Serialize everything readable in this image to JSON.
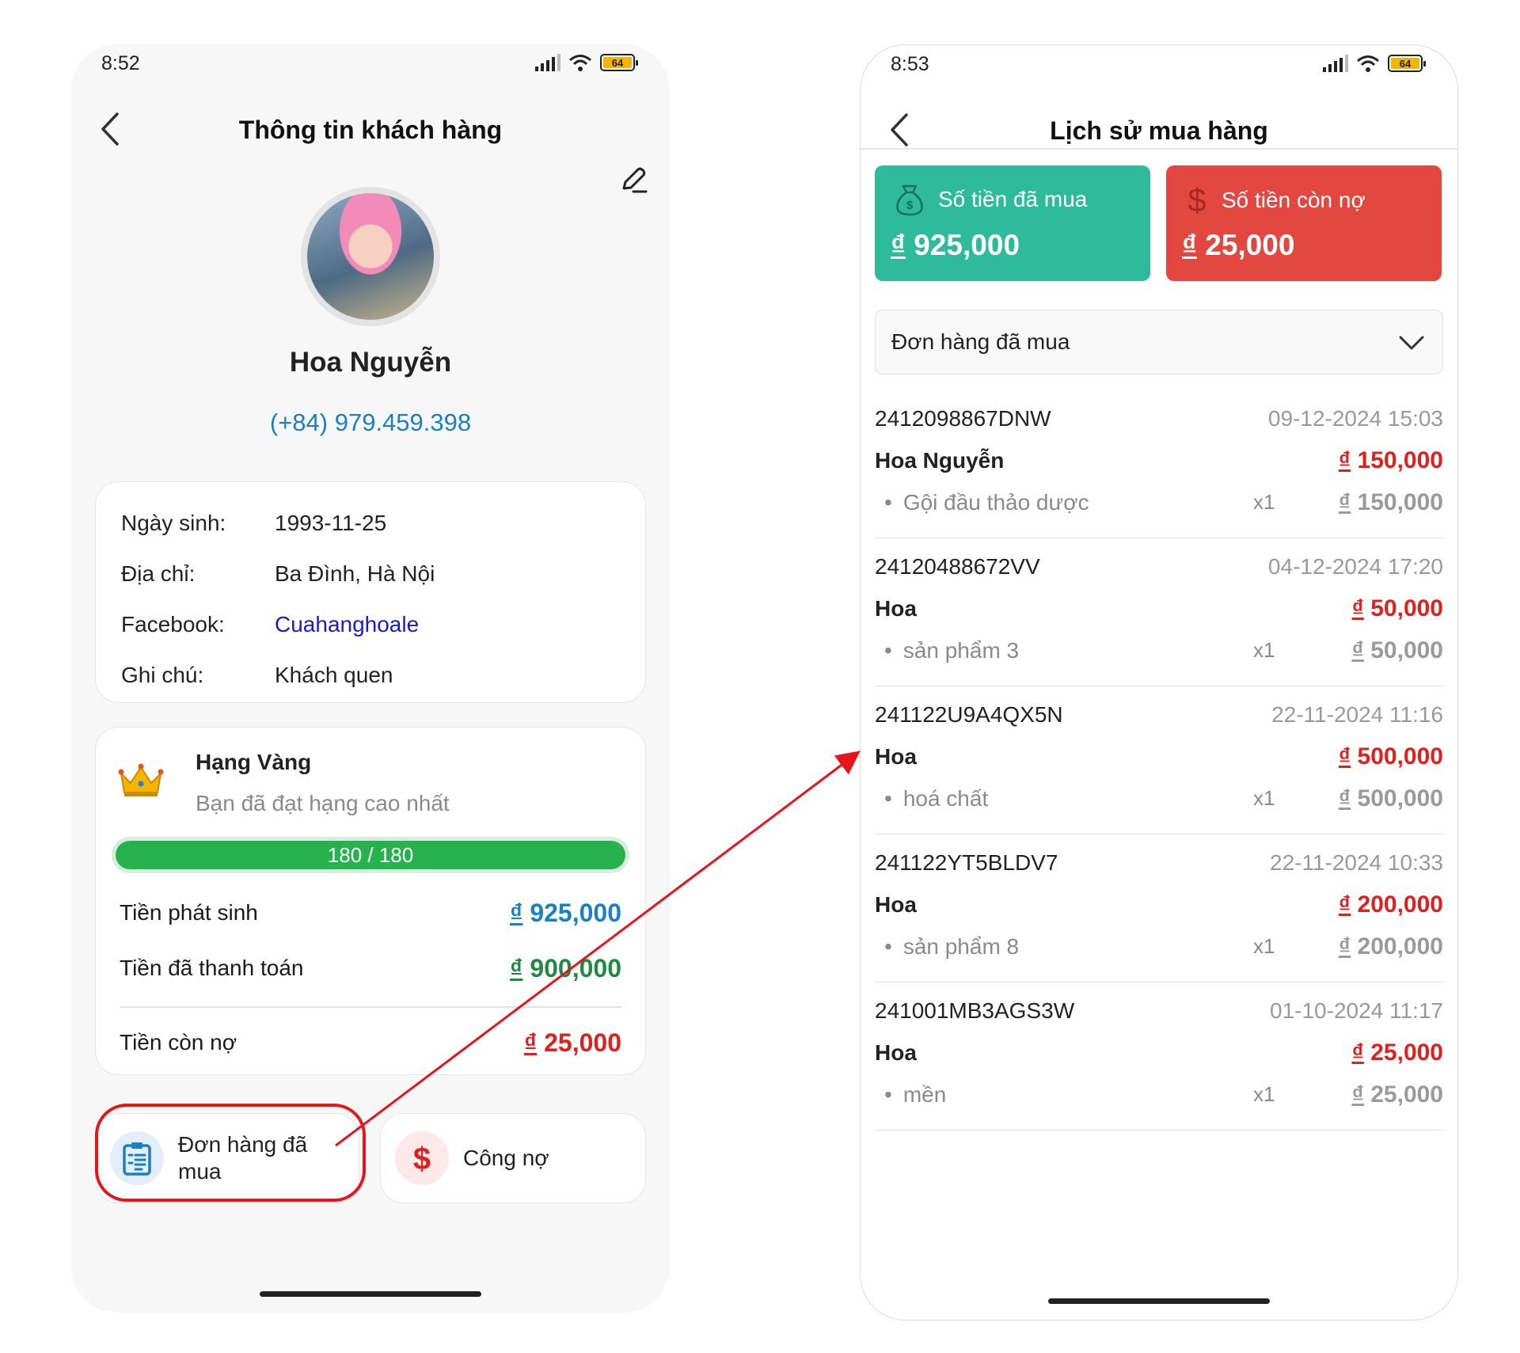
{
  "left_screen": {
    "status": {
      "time": "8:52",
      "battery": "64"
    },
    "title": "Thông tin khách hàng",
    "customer": {
      "name": "Hoa Nguyễn",
      "phone": "(+84) 979.459.398"
    },
    "info": [
      {
        "label": "Ngày sinh:",
        "value": "1993-11-25"
      },
      {
        "label": "Địa chỉ:",
        "value": "Ba Đình, Hà Nội"
      },
      {
        "label": "Facebook:",
        "value": "Cuahanghoale"
      },
      {
        "label": "Ghi chú:",
        "value": "Khách quen"
      }
    ],
    "rank": {
      "title": "Hạng Vàng",
      "subtitle": "Bạn đã đạt hạng cao nhất",
      "progress_text": "180 / 180",
      "progress_fraction": 1.0
    },
    "money": {
      "generated_label": "Tiền phát sinh",
      "generated_currency": "₫",
      "generated_value": "925,000",
      "paid_label": "Tiền đã thanh toán",
      "paid_currency": "₫",
      "paid_value": "900,000",
      "debt_label": "Tiền còn nợ",
      "debt_currency": "₫",
      "debt_value": "25,000"
    },
    "actions": {
      "orders_label_1": "Đơn hàng đã",
      "orders_label_2": "mua",
      "debt_label": "Công nợ"
    }
  },
  "right_screen": {
    "status": {
      "time": "8:53",
      "battery": "64"
    },
    "title": "Lịch sử mua hàng",
    "stats": {
      "paid_label": "Số tiền đã mua",
      "paid_currency": "₫",
      "paid_value": "925,000",
      "debt_label": "Số tiền còn nợ",
      "debt_currency": "₫",
      "debt_value": "25,000"
    },
    "filter": {
      "selected": "Đơn hàng đã mua"
    },
    "orders": [
      {
        "code": "2412098867DNW",
        "date": "09-12-2024 15:03",
        "customer": "Hoa Nguyễn",
        "currency": "₫",
        "total": "150,000",
        "item": "Gội đầu thảo dược",
        "qty": "x1",
        "item_amount": "150,000"
      },
      {
        "code": "24120488672VV",
        "date": "04-12-2024 17:20",
        "customer": "Hoa",
        "currency": "₫",
        "total": "50,000",
        "item": "sản phẩm 3",
        "qty": "x1",
        "item_amount": "50,000"
      },
      {
        "code": "241122U9A4QX5N",
        "date": "22-11-2024 11:16",
        "customer": "Hoa",
        "currency": "₫",
        "total": "500,000",
        "item": "hoá chất",
        "qty": "x1",
        "item_amount": "500,000"
      },
      {
        "code": "241122YT5BLDV7",
        "date": "22-11-2024 10:33",
        "customer": "Hoa",
        "currency": "₫",
        "total": "200,000",
        "item": "sản phẩm 8",
        "qty": "x1",
        "item_amount": "200,000"
      },
      {
        "code": "241001MB3AGS3W",
        "date": "01-10-2024 11:17",
        "customer": "Hoa",
        "currency": "₫",
        "total": "25,000",
        "item": "mền",
        "qty": "x1",
        "item_amount": "25,000"
      }
    ]
  },
  "colors": {
    "paid_stat": "#2dbb9b",
    "debt_stat": "#e2483f",
    "money_blue": "#1a7fc4",
    "money_green": "#1f8a45",
    "money_red": "#e0201e",
    "progress_green": "#26b34e",
    "annotation_red": "#e8141c"
  },
  "icons": [
    "back-chevron-icon",
    "edit-pencil-icon",
    "crown-icon",
    "clipboard-list-icon",
    "dollar-icon",
    "money-bag-icon",
    "chevron-down-icon",
    "signal-icon",
    "wifi-icon",
    "battery-icon"
  ]
}
